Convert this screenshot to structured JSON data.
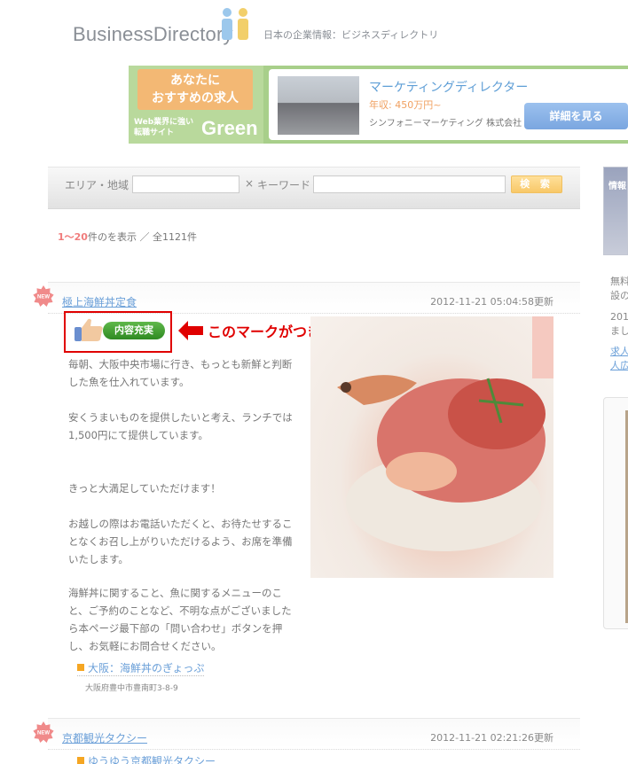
{
  "header": {
    "logo_part1": "Business",
    "logo_part2": "Directory",
    "tagline": "日本の企業情報：ビジネスディレクトリ"
  },
  "banner": {
    "headline_line1": "あなたに",
    "headline_line2": "おすすめの求人",
    "sub_line1": "Web業界に強い",
    "sub_line2": "転職サイト",
    "brand": "Green",
    "job_title": "マーケティングディレクター",
    "salary": "年収: 450万円~",
    "company": "シンフォニーマーケティング 株式会社",
    "button_label": "詳細を見る"
  },
  "search": {
    "area_label": "エリア・地域",
    "separator": "×",
    "keyword_label": "キーワード",
    "area_value": "",
    "keyword_value": "",
    "button_label": "検 索"
  },
  "results": {
    "range": "1～20",
    "suffix": "件のを表示 ／ 全1121件"
  },
  "entries": [
    {
      "badge": "NEW",
      "title": "極上海鮮丼定食",
      "updated": "2012-11-21 05:04:58更新",
      "mark_label": "内容充実",
      "annotation": "このマークがつきます",
      "description": [
        "毎朝、大阪中央市場に行き、もっとも新鮮と判断した魚を仕入れています。",
        "安くうまいものを提供したいと考え、ランチでは1,500円にて提供しています。",
        "きっと大満足していただけます！",
        "お越しの際はお電話いただくと、お待たせすることなくお召し上がりいただけるよう、お席を準備いたします。",
        "海鮮丼に関すること、魚に関するメニューのこと、ご予約のことなど、不明な点がございましたら本ページ最下部の「問い合わせ」ボタンを押し、お気軽にお問合せください。"
      ],
      "shop_name": "大阪：海鮮丼のぎょっぷ",
      "address": "大阪府豊中市豊南町3-8-9"
    },
    {
      "badge": "NEW",
      "title": "京都観光タクシー",
      "updated": "2012-11-21 02:21:26更新",
      "shop_name": "ゆうゆう京都観光タクシー"
    }
  ],
  "sidebar": {
    "box_title": "情報",
    "text1_line1": "無料",
    "text1_line2": "設の",
    "text2_line1": "201",
    "text2_line2": "まし",
    "link_line1": "求人",
    "link_line2": "人広"
  },
  "colors": {
    "link": "#6a9fd8",
    "annotation": "#e00000",
    "mark_badge": "#3f9e2f",
    "highlight_count": "#f07c7c"
  }
}
